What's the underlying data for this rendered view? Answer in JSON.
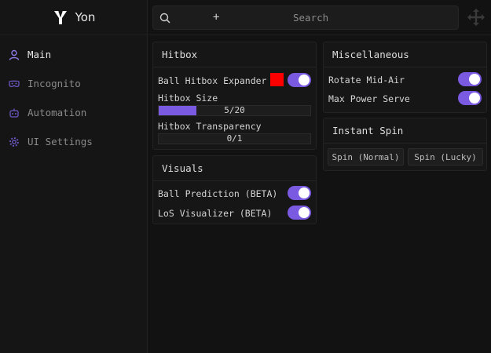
{
  "brand": {
    "name": "Yon",
    "logo_icon": "y-logo-icon"
  },
  "sidebar": {
    "items": [
      {
        "label": "Main",
        "icon": "user-icon",
        "active": true
      },
      {
        "label": "Incognito",
        "icon": "mask-icon",
        "active": false
      },
      {
        "label": "Automation",
        "icon": "robot-icon",
        "active": false
      },
      {
        "label": "UI Settings",
        "icon": "gear-icon",
        "active": false
      }
    ]
  },
  "search": {
    "placeholder": "Search",
    "add_symbol": "+"
  },
  "hitbox": {
    "title": "Hitbox",
    "expander_label": "Ball Hitbox Expander",
    "expander_on": true,
    "expander_color": "#ff0000",
    "size_label": "Hitbox Size",
    "size_value": "5/20",
    "size_fraction": 0.25,
    "transparency_label": "Hitbox Transparency",
    "transparency_value": "0/1",
    "transparency_fraction": 0
  },
  "visuals": {
    "title": "Visuals",
    "items": [
      {
        "label": "Ball Prediction (BETA)",
        "on": true
      },
      {
        "label": "LoS Visualizer (BETA)",
        "on": true
      }
    ]
  },
  "misc": {
    "title": "Miscellaneous",
    "items": [
      {
        "label": "Rotate Mid-Air",
        "on": true
      },
      {
        "label": "Max Power Serve",
        "on": true
      }
    ]
  },
  "instant_spin": {
    "title": "Instant Spin",
    "buttons": [
      "Spin (Normal)",
      "Spin (Lucky)"
    ]
  },
  "colors": {
    "accent": "#7a5ae0",
    "background": "#121212"
  }
}
